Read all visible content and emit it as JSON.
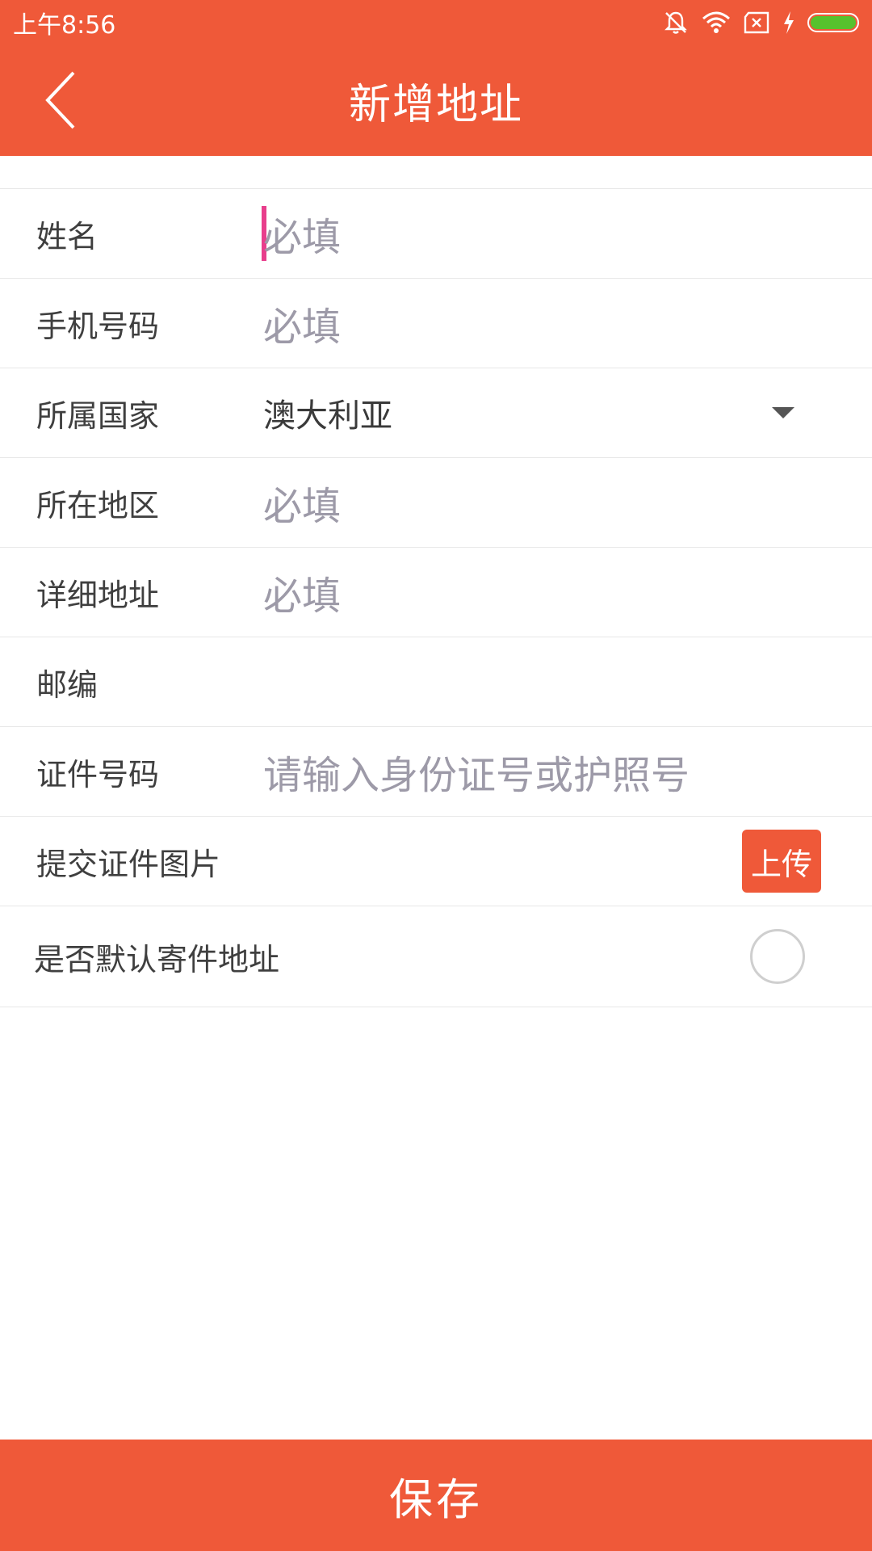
{
  "status_bar": {
    "time": "上午8:56",
    "icons": [
      "mute-bell-icon",
      "wifi-icon",
      "no-sim-icon",
      "charging-icon",
      "battery-icon"
    ],
    "battery_color": "#57c22d"
  },
  "header": {
    "title": "新增地址",
    "background": "#ef5939"
  },
  "form": {
    "name": {
      "label": "姓名",
      "placeholder": "必填"
    },
    "phone": {
      "label": "手机号码",
      "placeholder": "必填"
    },
    "country": {
      "label": "所属国家",
      "value": "澳大利亚"
    },
    "region": {
      "label": "所在地区",
      "placeholder": "必填"
    },
    "address": {
      "label": "详细地址",
      "placeholder": "必填"
    },
    "postcode": {
      "label": "邮编",
      "placeholder": ""
    },
    "id_number": {
      "label": "证件号码",
      "placeholder": "请输入身份证号或护照号"
    },
    "id_photo": {
      "label": "提交证件图片",
      "button": "上传"
    },
    "default": {
      "label": "是否默认寄件地址",
      "checked": false
    }
  },
  "footer": {
    "save_label": "保存"
  }
}
